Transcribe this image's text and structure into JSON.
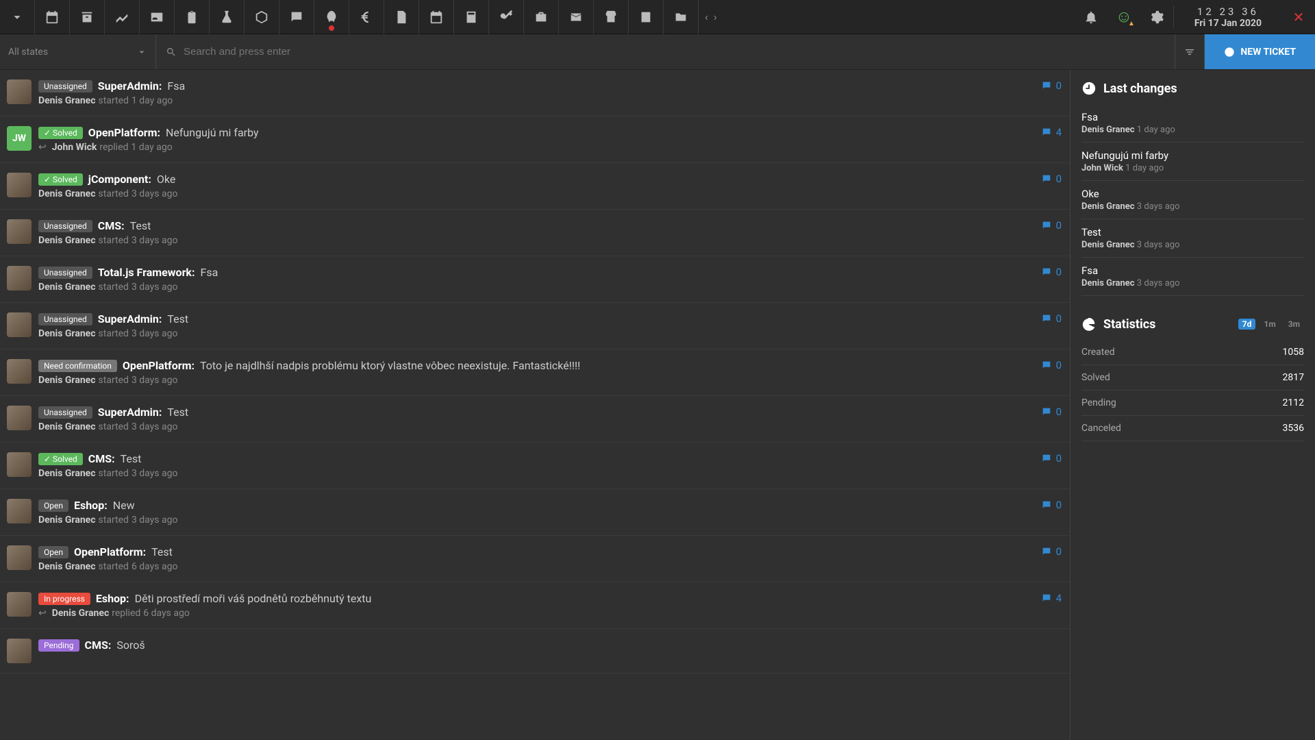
{
  "clock": {
    "time": "12 23 36",
    "date": "Fri 17 Jan 2020"
  },
  "search": {
    "placeholder": "Search and press enter"
  },
  "stateFilter": {
    "label": "All states"
  },
  "newTicket": {
    "label": "NEW TICKET"
  },
  "tickets": [
    {
      "avatar": "cat",
      "statusClass": "st-unassigned",
      "status": "Unassigned",
      "project": "SuperAdmin:",
      "title": "Fsa",
      "reply": false,
      "author": "Denis Granec",
      "action": "started",
      "ago": "1 day ago",
      "comments": "0"
    },
    {
      "avatar": "jw",
      "avatarText": "JW",
      "statusClass": "st-solved",
      "statusIcon": true,
      "status": "Solved",
      "project": "OpenPlatform:",
      "title": "Nefungujú mi farby",
      "reply": true,
      "author": "John Wick",
      "action": "replied",
      "ago": "1 day ago",
      "comments": "4"
    },
    {
      "avatar": "cat",
      "statusClass": "st-solved",
      "statusIcon": true,
      "status": "Solved",
      "project": "jComponent:",
      "title": "Oke",
      "reply": false,
      "author": "Denis Granec",
      "action": "started",
      "ago": "3 days ago",
      "comments": "0"
    },
    {
      "avatar": "cat",
      "statusClass": "st-unassigned",
      "status": "Unassigned",
      "project": "CMS:",
      "title": "Test",
      "reply": false,
      "author": "Denis Granec",
      "action": "started",
      "ago": "3 days ago",
      "comments": "0"
    },
    {
      "avatar": "cat",
      "statusClass": "st-unassigned",
      "status": "Unassigned",
      "project": "Total.js Framework:",
      "title": "Fsa",
      "reply": false,
      "author": "Denis Granec",
      "action": "started",
      "ago": "3 days ago",
      "comments": "0"
    },
    {
      "avatar": "cat",
      "statusClass": "st-unassigned",
      "status": "Unassigned",
      "project": "SuperAdmin:",
      "title": "Test",
      "reply": false,
      "author": "Denis Granec",
      "action": "started",
      "ago": "3 days ago",
      "comments": "0"
    },
    {
      "avatar": "cat",
      "statusClass": "st-need",
      "status": "Need confirmation",
      "project": "OpenPlatform:",
      "title": "Toto je najdlhší nadpis problému ktorý vlastne vôbec neexistuje. Fantastické!!!!",
      "reply": false,
      "author": "Denis Granec",
      "action": "started",
      "ago": "3 days ago",
      "comments": "0"
    },
    {
      "avatar": "cat",
      "statusClass": "st-unassigned",
      "status": "Unassigned",
      "project": "SuperAdmin:",
      "title": "Test",
      "reply": false,
      "author": "Denis Granec",
      "action": "started",
      "ago": "3 days ago",
      "comments": "0"
    },
    {
      "avatar": "cat",
      "statusClass": "st-solved",
      "statusIcon": true,
      "status": "Solved",
      "project": "CMS:",
      "title": "Test",
      "reply": false,
      "author": "Denis Granec",
      "action": "started",
      "ago": "3 days ago",
      "comments": "0"
    },
    {
      "avatar": "cat",
      "statusClass": "st-open",
      "status": "Open",
      "project": "Eshop:",
      "title": "New",
      "reply": false,
      "author": "Denis Granec",
      "action": "started",
      "ago": "3 days ago",
      "comments": "0"
    },
    {
      "avatar": "cat",
      "statusClass": "st-open",
      "status": "Open",
      "project": "OpenPlatform:",
      "title": "Test",
      "reply": false,
      "author": "Denis Granec",
      "action": "started",
      "ago": "6 days ago",
      "comments": "0"
    },
    {
      "avatar": "cat",
      "statusClass": "st-progress",
      "status": "In progress",
      "project": "Eshop:",
      "title": "Děti prostředí moři váš podnětů rozběhnutý textu",
      "reply": true,
      "author": "Denis Granec",
      "action": "replied",
      "ago": "6 days ago",
      "comments": "4"
    },
    {
      "avatar": "cat",
      "statusClass": "st-pending",
      "status": "Pending",
      "project": "CMS:",
      "title": "Soroš",
      "reply": false,
      "author": "",
      "action": "",
      "ago": "",
      "comments": ""
    }
  ],
  "lastChanges": {
    "header": "Last changes",
    "items": [
      {
        "title": "Fsa",
        "author": "Denis Granec",
        "ago": "1 day ago"
      },
      {
        "title": "Nefungujú mi farby",
        "author": "John Wick",
        "ago": "1 day ago"
      },
      {
        "title": "Oke",
        "author": "Denis Granec",
        "ago": "3 days ago"
      },
      {
        "title": "Test",
        "author": "Denis Granec",
        "ago": "3 days ago"
      },
      {
        "title": "Fsa",
        "author": "Denis Granec",
        "ago": "3 days ago"
      }
    ]
  },
  "statistics": {
    "header": "Statistics",
    "tabs": [
      "7d",
      "1m",
      "3m"
    ],
    "rows": [
      {
        "label": "Created",
        "value": "1058"
      },
      {
        "label": "Solved",
        "value": "2817"
      },
      {
        "label": "Pending",
        "value": "2112"
      },
      {
        "label": "Canceled",
        "value": "3536"
      }
    ]
  }
}
